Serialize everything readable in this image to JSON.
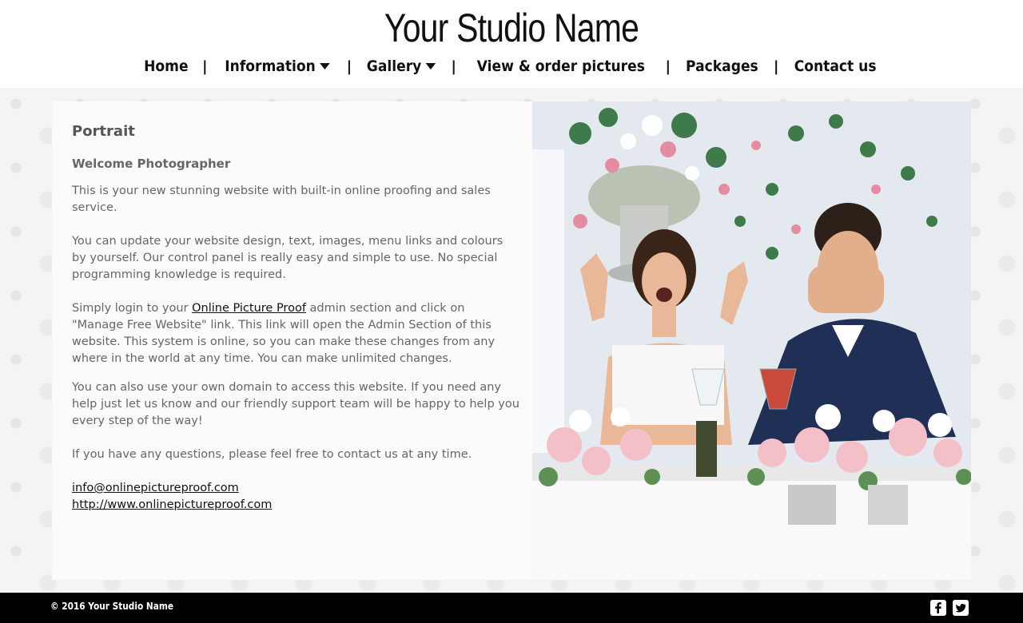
{
  "header": {
    "studio_name": "Your Studio Name"
  },
  "nav": {
    "items": [
      {
        "label": "Home"
      },
      {
        "label": "Information"
      },
      {
        "label": "Gallery"
      },
      {
        "label": "View & order pictures"
      },
      {
        "label": "Packages"
      },
      {
        "label": "Contact us"
      }
    ],
    "separator": "|"
  },
  "content": {
    "title": "Portrait",
    "subtitle": "Welcome Photographer",
    "p1": "This is your new stunning website with built-in online proofing and sales service.",
    "p2": "You can update your website design, text, images, menu links and colours by yourself. Our control panel is really easy and simple to use. No special programming knowledge is required.",
    "p3_before": "Simply login to your ",
    "p3_link": "Online Picture Proof",
    "p3_after": " admin section and click on \"Manage Free Website\" link. This link will open the Admin Section of this website. This system is online, so you can make these changes from any where in the world at any time. You can make unlimited changes.",
    "p4": "You can also use your own domain to access this website. If you need any help just let us know and our friendly support team will be happy to help you every step of the way!",
    "p5": "If you have any questions, please feel free to contact us at any time.",
    "email": "info@onlinepictureproof.com",
    "website": "http://www.onlinepictureproof.com"
  },
  "footer": {
    "copyright": "© 2016 Your Studio Name",
    "icons": [
      "facebook-icon",
      "twitter-icon"
    ]
  },
  "colors": {
    "footer_bg": "#000000",
    "text": "#666666",
    "link": "#111111"
  }
}
